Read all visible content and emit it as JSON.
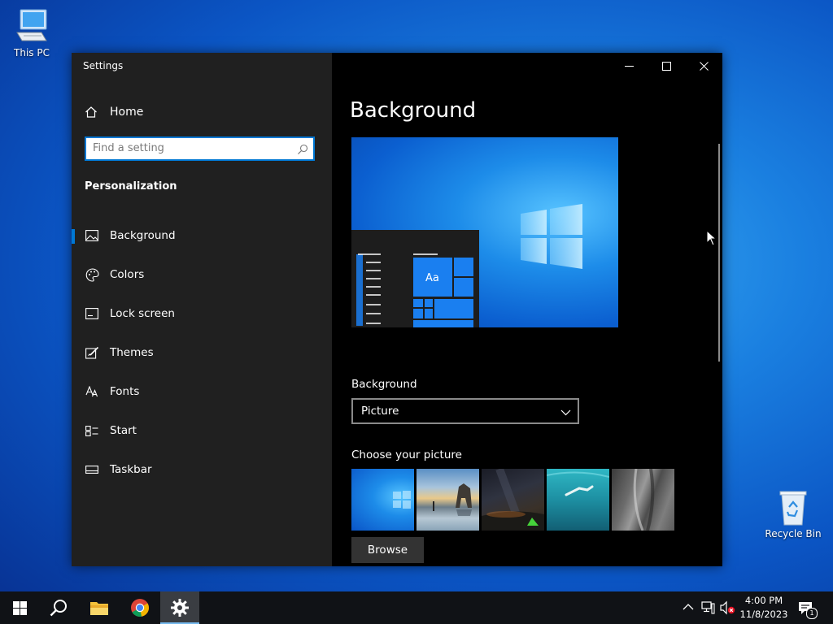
{
  "desktop": {
    "this_pc_label": "This PC",
    "recycle_bin_label": "Recycle Bin"
  },
  "window": {
    "title": "Settings",
    "controls": [
      "minimize-icon",
      "maximize-icon",
      "close-icon"
    ]
  },
  "sidebar": {
    "home_label": "Home",
    "search_placeholder": "Find a setting",
    "section_title": "Personalization",
    "items": [
      {
        "label": "Background",
        "icon": "picture-icon",
        "active": true
      },
      {
        "label": "Colors",
        "icon": "palette-icon",
        "active": false
      },
      {
        "label": "Lock screen",
        "icon": "lock-screen-icon",
        "active": false
      },
      {
        "label": "Themes",
        "icon": "themes-icon",
        "active": false
      },
      {
        "label": "Fonts",
        "icon": "fonts-icon",
        "active": false
      },
      {
        "label": "Start",
        "icon": "start-icon",
        "active": false
      },
      {
        "label": "Taskbar",
        "icon": "taskbar-icon",
        "active": false
      }
    ]
  },
  "content": {
    "page_title": "Background",
    "preview_tile_text": "Aa",
    "background_label": "Background",
    "background_value": "Picture",
    "choose_label": "Choose your picture",
    "thumbnails": [
      "windows-light-bg",
      "coast-rock-arch",
      "night-sky-tent",
      "underwater-swimmer",
      "rock-cliff"
    ],
    "browse_label": "Browse"
  },
  "taskbar": {
    "apps": [
      "start-icon",
      "search-icon",
      "file-explorer-icon",
      "chrome-icon",
      "settings-icon"
    ],
    "active_app": "settings-icon",
    "time": "4:00 PM",
    "date": "11/8/2023",
    "notification_count": "1"
  },
  "colors": {
    "accent": "#0078d4",
    "sidebar_bg": "#202020",
    "content_bg": "#000000",
    "taskbar_bg": "#101216"
  }
}
